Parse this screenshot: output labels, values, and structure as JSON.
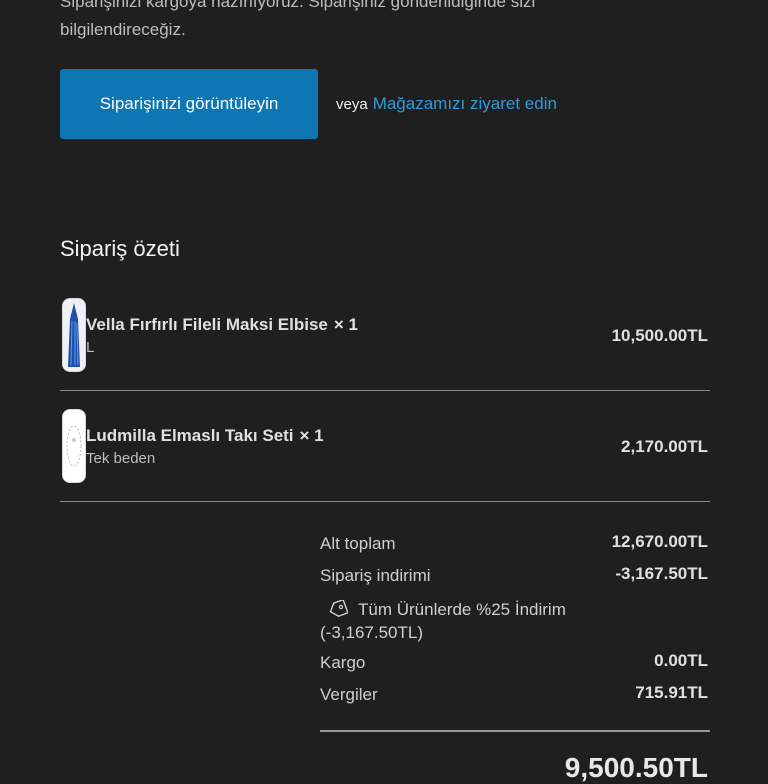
{
  "intro": {
    "line1": "Siparişinizi kargoya hazırlıyoruz. Siparişiniz gönderildiğinde sizi",
    "line2": "bilgilendireceğiz."
  },
  "actions": {
    "view_order_label": "Siparişinizi görüntüleyin",
    "or_label": "veya",
    "visit_store_label": "Mağazamızı ziyaret edin"
  },
  "summary": {
    "title": "Sipariş özeti",
    "items": [
      {
        "name": "Vella Fırfırlı Fileli Maksi Elbise",
        "qty": "× 1",
        "variant": "L",
        "price": "10,500.00TL"
      },
      {
        "name": "Ludmilla Elmaslı Takı Seti",
        "qty": "× 1",
        "variant": "Tek beden",
        "price": "2,170.00TL"
      }
    ],
    "subtotal_label": "Alt toplam",
    "subtotal_value": "12,670.00TL",
    "discount_label": "Sipariş indirimi",
    "discount_value": "-3,167.50TL",
    "discount_name": "Tüm Ürünlerde %25 İndirim",
    "discount_amount": "(-3,167.50TL)",
    "shipping_label": "Kargo",
    "shipping_value": "0.00TL",
    "tax_label": "Vergiler",
    "tax_value": "715.91TL",
    "total_value": "9,500.50TL"
  },
  "icons": {
    "discount": "tag-icon"
  },
  "colors": {
    "accent": "#0d76b3",
    "link": "#2f9ad8",
    "background": "#1f1f1f"
  }
}
